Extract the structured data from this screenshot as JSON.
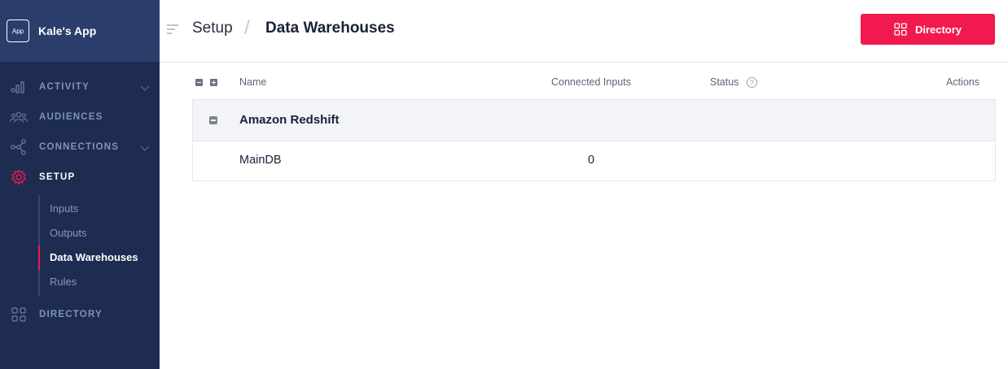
{
  "app": {
    "badge": "App",
    "name": "Kale's App"
  },
  "sidebar": {
    "items": [
      {
        "label": "ACTIVITY",
        "icon": "bar-chart-icon",
        "has_chevron": true
      },
      {
        "label": "AUDIENCES",
        "icon": "people-icon",
        "has_chevron": false
      },
      {
        "label": "CONNECTIONS",
        "icon": "network-icon",
        "has_chevron": true
      },
      {
        "label": "SETUP",
        "icon": "gear-icon",
        "has_chevron": false,
        "active": true
      },
      {
        "label": "DIRECTORY",
        "icon": "grid-icon",
        "has_chevron": false
      }
    ],
    "setup_subitems": [
      {
        "label": "Inputs"
      },
      {
        "label": "Outputs"
      },
      {
        "label": "Data Warehouses",
        "active": true
      },
      {
        "label": "Rules"
      }
    ]
  },
  "header": {
    "breadcrumb_root": "Setup",
    "breadcrumb_separator": "/",
    "breadcrumb_current": "Data Warehouses",
    "directory_button": "Directory"
  },
  "table": {
    "columns": {
      "name": "Name",
      "connected_inputs": "Connected Inputs",
      "status": "Status",
      "status_help": "?",
      "actions": "Actions"
    },
    "groups": [
      {
        "name": "Amazon Redshift",
        "rows": [
          {
            "name": "MainDB",
            "connected_inputs": "0"
          }
        ]
      }
    ]
  },
  "colors": {
    "sidebar_bg": "#1e2c52",
    "brand_bg": "#2b3d6b",
    "accent": "#f2194f",
    "group_row_bg": "#f3f4f7"
  }
}
